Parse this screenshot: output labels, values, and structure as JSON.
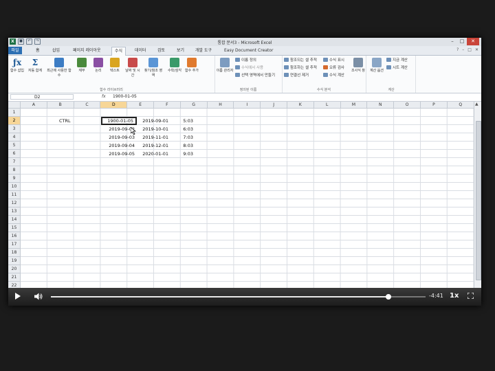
{
  "window": {
    "title": "통합 문서3 - Microsoft Excel",
    "app_icon": "X"
  },
  "tabs": [
    {
      "label": "파일"
    },
    {
      "label": "홈"
    },
    {
      "label": "삽입"
    },
    {
      "label": "페이지 레이아웃"
    },
    {
      "label": "수식"
    },
    {
      "label": "데이터"
    },
    {
      "label": "검토"
    },
    {
      "label": "보기"
    },
    {
      "label": "개발 도구"
    },
    {
      "label": "Easy Document Creator"
    }
  ],
  "active_tab": "수식",
  "ribbon": {
    "insert_function": "함수 삽입",
    "autosum": "자동 합계",
    "recent": "최근에 사용한 함수",
    "financial": "재무",
    "logical": "논리",
    "text": "텍스트",
    "datetime": "날짜 및 시간",
    "lookup": "찾기/참조 영역",
    "math": "수학/삼각",
    "more": "함수 추가",
    "group_library": "함수 라이브러리",
    "name_manager": "이름 관리자",
    "define_name": "이름 정의",
    "use_in_formula": "수식에서 사용",
    "create_from_selection": "선택 영역에서 만들기",
    "group_names": "정의된 이름",
    "trace_precedents": "참조되는 셀 추적",
    "trace_dependents": "참조하는 셀 추적",
    "remove_arrows": "연결선 제거",
    "show_formulas": "수식 표시",
    "error_checking": "오류 검사",
    "evaluate_formula": "수식 계산",
    "watch_window": "조사식 창",
    "group_auditing": "수식 분석",
    "calc_options": "계산 옵션",
    "calc_now": "지금 계산",
    "calc_sheet": "시트 계산",
    "group_calc": "계산"
  },
  "formula_bar": {
    "name_box": "D2",
    "fx": "fx",
    "value": "1900-01-05"
  },
  "columns": [
    "A",
    "B",
    "C",
    "D",
    "E",
    "F",
    "G",
    "H",
    "I",
    "J",
    "K",
    "L",
    "M",
    "N",
    "O",
    "P",
    "Q"
  ],
  "rows": [
    "1",
    "2",
    "3",
    "4",
    "5",
    "6",
    "7",
    "8",
    "9",
    "10",
    "11",
    "12",
    "13",
    "14",
    "15",
    "16",
    "17",
    "18",
    "19",
    "20",
    "21",
    "22"
  ],
  "cells": {
    "B2": "CTRL",
    "D2": "1900-01-05",
    "D3": "2019-09-02",
    "D4": "2019-09-03",
    "D5": "2019-09-04",
    "D6": "2019-09-05",
    "E2": "2019-09-01",
    "E3": "2019-10-01",
    "E4": "2019-11-01",
    "E5": "2019-12-01",
    "E6": "2020-01-01",
    "F2": "5:03",
    "F3": "6:03",
    "F4": "7:03",
    "F5": "8:03",
    "F6": "9:03"
  },
  "player": {
    "time": "-4:41",
    "speed": "1x",
    "progress": 0.9
  }
}
